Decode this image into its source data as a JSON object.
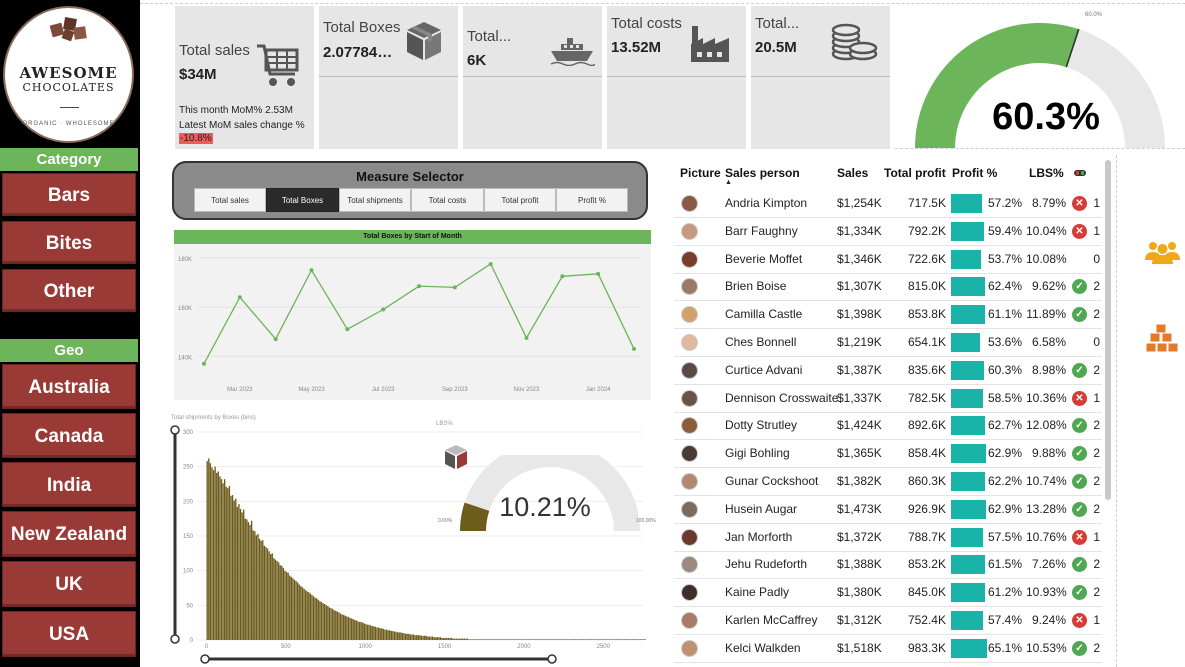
{
  "brand": {
    "line1": "AWESOME",
    "line2": "CHOCOLATES",
    "tagline": "ORGANIC · WHOLESOME"
  },
  "nav": {
    "category_title": "Category",
    "category_items": [
      "Bars",
      "Bites",
      "Other"
    ],
    "geo_title": "Geo",
    "geo_items": [
      "Australia",
      "Canada",
      "India",
      "New Zealand",
      "UK",
      "USA"
    ]
  },
  "kpis": {
    "total_sales": {
      "label": "Total sales",
      "value": "$34M",
      "icon": "shopping-cart-icon"
    },
    "total_boxes": {
      "label": "Total Boxes",
      "value": "2.07784…",
      "icon": "box-icon"
    },
    "total_shipments": {
      "label": "Total...",
      "value": "6K",
      "icon": "ship-icon"
    },
    "total_costs": {
      "label": "Total costs",
      "value": "13.52M",
      "icon": "factory-icon"
    },
    "total_profit": {
      "label": "Total...",
      "value": "20.5M",
      "icon": "coins-icon"
    },
    "mom_line": "This month MoM% 2.53M",
    "mom_change_label": "Latest MoM sales change %",
    "mom_change_value": "-10.8%"
  },
  "profit_gauge": {
    "value_text": "60.3%",
    "value": 0.603,
    "target_label": "60.0%",
    "color": "#6db55b"
  },
  "measure_selector": {
    "title": "Measure Selector",
    "options": [
      "Total sales",
      "Total Boxes",
      "Total shipments",
      "Total costs",
      "Total profit",
      "Profit %"
    ],
    "selected": "Total Boxes"
  },
  "line_chart_title": "Total Boxes by Start of Month",
  "histogram_title": "Total shipments by Boxes (bins)",
  "lbs_gauge": {
    "title": "LBS%",
    "value_text": "10.21%",
    "value": 0.1021,
    "min_label": "0.00%",
    "max_label": "100.00%",
    "color": "#6e5c1c"
  },
  "chart_data": [
    {
      "type": "line",
      "title": "Total Boxes by Start of Month",
      "x": [
        "Feb 2023",
        "Mar 2023",
        "Apr 2023",
        "May 2023",
        "Jun 2023",
        "Jul 2023",
        "Aug 2023",
        "Sep 2023",
        "Oct 2023",
        "Nov 2023",
        "Dec 2023",
        "Jan 2024",
        "Feb 2024"
      ],
      "xticks": [
        "Mar 2023",
        "May 2023",
        "Jul 2023",
        "Sep 2023",
        "Nov 2023",
        "Jan 2024"
      ],
      "values": [
        137000,
        164000,
        147000,
        175000,
        151000,
        159000,
        168500,
        168000,
        177500,
        147500,
        172500,
        173500,
        143000
      ],
      "ylim": [
        132000,
        184000
      ],
      "yticks": [
        140000,
        160000,
        180000
      ],
      "ytick_labels": [
        "140K",
        "160K",
        "180K"
      ],
      "color": "#6db55b"
    },
    {
      "type": "bar",
      "title": "Total shipments by Boxes (bins)",
      "bin_width": 10,
      "x_start": 0,
      "ylim": [
        0,
        300
      ],
      "yticks": [
        0,
        50,
        100,
        150,
        200,
        250,
        300
      ],
      "xticks": [
        0,
        500,
        1000,
        1500,
        2000,
        2500
      ],
      "xlim": [
        -60,
        2750
      ],
      "values": [
        258,
        262,
        255,
        249,
        245,
        250,
        241,
        243,
        236,
        232,
        226,
        232,
        221,
        219,
        222,
        208,
        209,
        201,
        204,
        192,
        196,
        189,
        184,
        188,
        175,
        174,
        170,
        166,
        172,
        158,
        157,
        151,
        153,
        146,
        143,
        144,
        136,
        134,
        132,
        128,
        124,
        125,
        118,
        116,
        114,
        112,
        108,
        107,
        104,
        100,
        98,
        97,
        93,
        91,
        89,
        87,
        85,
        83,
        80,
        78,
        76,
        74,
        72,
        70,
        69,
        67,
        65,
        63,
        61,
        60,
        58,
        56,
        55,
        53,
        52,
        50,
        49,
        47,
        46,
        45,
        43,
        42,
        41,
        40,
        38,
        37,
        36,
        35,
        34,
        33,
        32,
        31,
        30,
        29,
        28,
        27,
        26,
        26,
        25,
        24,
        23,
        22,
        22,
        21,
        20,
        20,
        19,
        18,
        18,
        17,
        17,
        16,
        15,
        15,
        14,
        14,
        13,
        13,
        12,
        12,
        11,
        11,
        11,
        10,
        10,
        9,
        9,
        9,
        8,
        8,
        8,
        7,
        7,
        7,
        7,
        6,
        6,
        6,
        6,
        5,
        5,
        5,
        5,
        4,
        4,
        4,
        4,
        4,
        3,
        3,
        3,
        3,
        3,
        3,
        3,
        2,
        2,
        2,
        2,
        2,
        2,
        2,
        2,
        2,
        2,
        1,
        1,
        1,
        1,
        1,
        1,
        1,
        1,
        1,
        1,
        1,
        1,
        1,
        1,
        1,
        1,
        1,
        1,
        1,
        1,
        1,
        1,
        1,
        1,
        1,
        1,
        1,
        1,
        1,
        1,
        1,
        1,
        1,
        1,
        1,
        1,
        1,
        1,
        1,
        1,
        1,
        1,
        1,
        1,
        1,
        1,
        1,
        1,
        1,
        1,
        1,
        1,
        1,
        1,
        1,
        1,
        1,
        1,
        1,
        1,
        1,
        1,
        1,
        1,
        1,
        1,
        1,
        1,
        1,
        1,
        1,
        1,
        1,
        1,
        1,
        1,
        1,
        1,
        1,
        1,
        1,
        1,
        1,
        1,
        1,
        1,
        1,
        1,
        1,
        1,
        1,
        1,
        1,
        1,
        1,
        1,
        1,
        1,
        1,
        1,
        1,
        1,
        1,
        1,
        1,
        1,
        1,
        1,
        1,
        1,
        1,
        1
      ],
      "color": "#6e5c1c"
    },
    {
      "type": "table",
      "columns": [
        "Picture",
        "Sales person",
        "Sales",
        "Total profit",
        "Profit %",
        "LBS%",
        ""
      ],
      "rows": [
        {
          "name": "Andria Kimpton",
          "sales": "$1,254K",
          "profit": "717.5K",
          "profit_pct": "57.2%",
          "pct": 0.572,
          "lbs": "8.79%",
          "status": "bad",
          "count": "1",
          "avatar": "#8a5a44"
        },
        {
          "name": "Barr Faughny",
          "sales": "$1,334K",
          "profit": "792.2K",
          "profit_pct": "59.4%",
          "pct": 0.594,
          "lbs": "10.04%",
          "status": "bad",
          "count": "1",
          "avatar": "#c49a80"
        },
        {
          "name": "Beverie Moffet",
          "sales": "$1,346K",
          "profit": "722.6K",
          "profit_pct": "53.7%",
          "pct": 0.537,
          "lbs": "10.08%",
          "status": "none",
          "count": "0",
          "avatar": "#7a3d2a"
        },
        {
          "name": "Brien Boise",
          "sales": "$1,307K",
          "profit": "815.0K",
          "profit_pct": "62.4%",
          "pct": 0.624,
          "lbs": "9.62%",
          "status": "ok",
          "count": "2",
          "avatar": "#9a7a66"
        },
        {
          "name": "Camilla Castle",
          "sales": "$1,398K",
          "profit": "853.8K",
          "profit_pct": "61.1%",
          "pct": 0.611,
          "lbs": "11.89%",
          "status": "ok",
          "count": "2",
          "avatar": "#d3a26c"
        },
        {
          "name": "Ches Bonnell",
          "sales": "$1,219K",
          "profit": "654.1K",
          "profit_pct": "53.6%",
          "pct": 0.536,
          "lbs": "6.58%",
          "status": "none",
          "count": "0",
          "avatar": "#e0b8a0"
        },
        {
          "name": "Curtice Advani",
          "sales": "$1,387K",
          "profit": "835.6K",
          "profit_pct": "60.3%",
          "pct": 0.603,
          "lbs": "8.98%",
          "status": "ok",
          "count": "2",
          "avatar": "#5a4a44"
        },
        {
          "name": "Dennison Crosswaite",
          "sales": "$1,337K",
          "profit": "782.5K",
          "profit_pct": "58.5%",
          "pct": 0.585,
          "lbs": "10.36%",
          "status": "bad",
          "count": "1",
          "avatar": "#6a5248"
        },
        {
          "name": "Dotty Strutley",
          "sales": "$1,424K",
          "profit": "892.6K",
          "profit_pct": "62.7%",
          "pct": 0.627,
          "lbs": "12.08%",
          "status": "ok",
          "count": "2",
          "avatar": "#8b5e3c"
        },
        {
          "name": "Gigi Bohling",
          "sales": "$1,365K",
          "profit": "858.4K",
          "profit_pct": "62.9%",
          "pct": 0.629,
          "lbs": "9.88%",
          "status": "ok",
          "count": "2",
          "avatar": "#4a3a34"
        },
        {
          "name": "Gunar Cockshoot",
          "sales": "$1,382K",
          "profit": "860.3K",
          "profit_pct": "62.2%",
          "pct": 0.622,
          "lbs": "10.74%",
          "status": "ok",
          "count": "2",
          "avatar": "#b08a70"
        },
        {
          "name": "Husein Augar",
          "sales": "$1,473K",
          "profit": "926.9K",
          "profit_pct": "62.9%",
          "pct": 0.629,
          "lbs": "13.28%",
          "status": "ok",
          "count": "2",
          "avatar": "#7d6a5f"
        },
        {
          "name": "Jan Morforth",
          "sales": "$1,372K",
          "profit": "788.7K",
          "profit_pct": "57.5%",
          "pct": 0.575,
          "lbs": "10.76%",
          "status": "bad",
          "count": "1",
          "avatar": "#6b3a2e"
        },
        {
          "name": "Jehu Rudeforth",
          "sales": "$1,388K",
          "profit": "853.2K",
          "profit_pct": "61.5%",
          "pct": 0.615,
          "lbs": "7.26%",
          "status": "ok",
          "count": "2",
          "avatar": "#9a8a80"
        },
        {
          "name": "Kaine Padly",
          "sales": "$1,380K",
          "profit": "845.0K",
          "profit_pct": "61.2%",
          "pct": 0.612,
          "lbs": "10.93%",
          "status": "ok",
          "count": "2",
          "avatar": "#3e2e2a"
        },
        {
          "name": "Karlen McCaffrey",
          "sales": "$1,312K",
          "profit": "752.4K",
          "profit_pct": "57.4%",
          "pct": 0.574,
          "lbs": "9.24%",
          "status": "bad",
          "count": "1",
          "avatar": "#a87c64"
        },
        {
          "name": "Kelci Walkden",
          "sales": "$1,518K",
          "profit": "983.3K",
          "profit_pct": "65.1%",
          "pct": 0.651,
          "lbs": "10.53%",
          "status": "ok",
          "count": "2",
          "avatar": "#c09070"
        }
      ]
    }
  ],
  "side_icons": [
    "people-icon",
    "boxes-icon"
  ],
  "colors": {
    "accent_green": "#6db55b",
    "nav_red": "#9a3a36",
    "bar_teal": "#19b3a8",
    "ok": "#4ea852",
    "bad": "#d63b35"
  }
}
